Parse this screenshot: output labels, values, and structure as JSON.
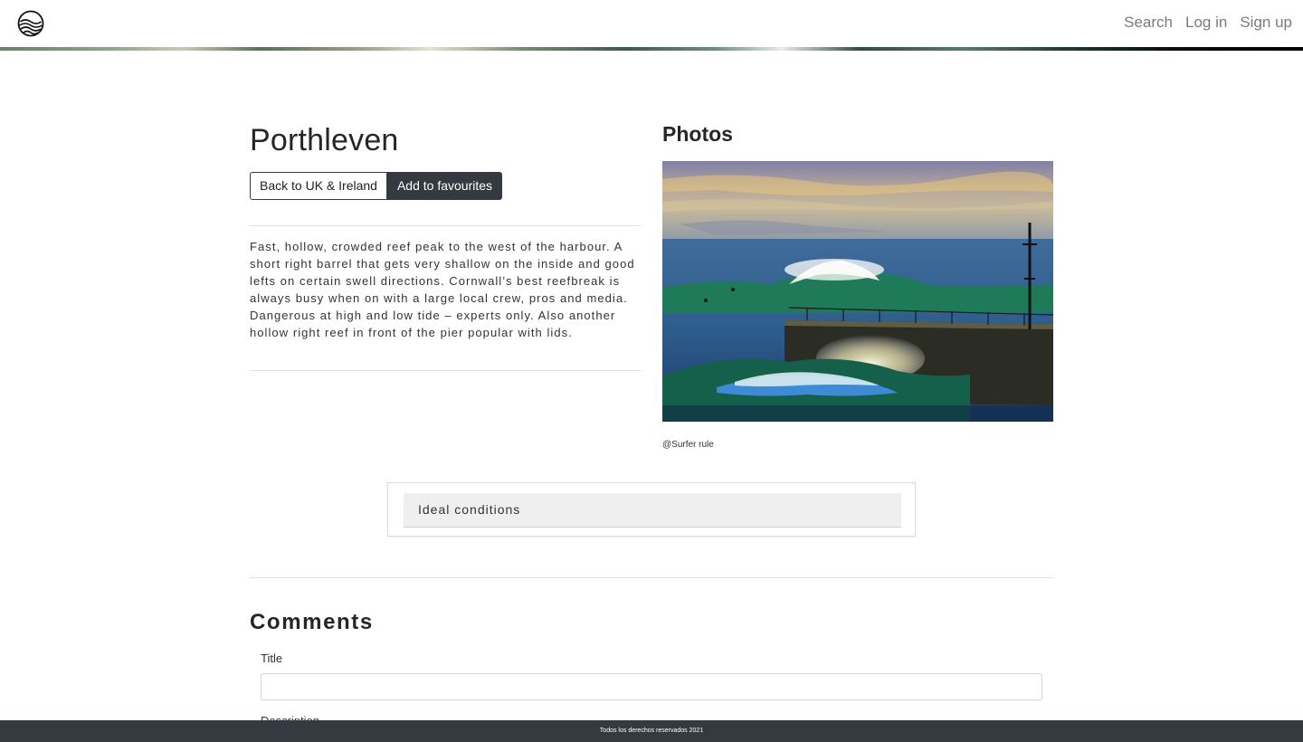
{
  "nav": {
    "search": "Search",
    "login": "Log in",
    "signup": "Sign up"
  },
  "spot": {
    "title": "Porthleven",
    "back_label": "Back to UK & Ireland",
    "favourite_label": "Add to favourites",
    "description": "Fast, hollow, crowded reef peak to the west of the harbour. A short right barrel that gets very shallow on the inside and good lefts on certain swell directions. Cornwall’s best reefbreak is always busy when on with a large local crew, pros and media. Dangerous at high and low tide – experts only. Also another hollow right reef in front of the pier popular with lids."
  },
  "photos": {
    "heading": "Photos",
    "credit": "@Surfer rule"
  },
  "conditions": {
    "label": "Ideal conditions"
  },
  "comments": {
    "heading": "Comments",
    "title_label": "Title",
    "title_value": "",
    "description_label": "Description"
  },
  "footer": {
    "text": "Todos los derechos reservados 2021"
  },
  "colors": {
    "dark": "#343a40",
    "nav_text": "#7b7b7b"
  }
}
